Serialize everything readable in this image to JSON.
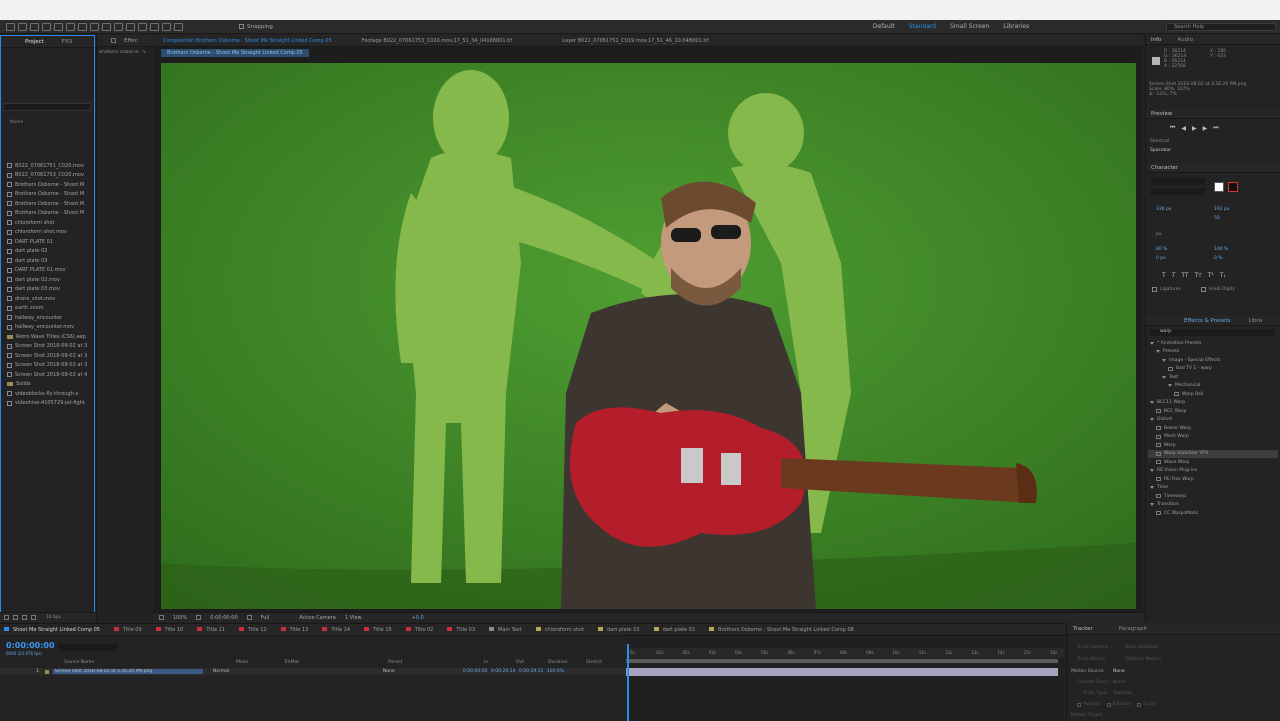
{
  "toolbar": {
    "snapping_label": "Snapping",
    "workspaces": [
      "Default",
      "Standard",
      "Small Screen",
      "Libraries"
    ],
    "active_workspace": "Standard",
    "search_placeholder": "Search Help"
  },
  "project_panel": {
    "tabs": [
      "Project",
      "FX3"
    ],
    "column_name": "Name",
    "items": [
      {
        "label": "B022_07061751_C020.mov",
        "kind": "file"
      },
      {
        "label": "B022_07061753_C020.mov",
        "kind": "file"
      },
      {
        "label": "Brothers Osborne - Shoot M",
        "kind": "comp"
      },
      {
        "label": "Brothers Osborne - Shoot M",
        "kind": "comp"
      },
      {
        "label": "Brothers Osborne - Shoot M",
        "kind": "comp"
      },
      {
        "label": "Brothers Osborne - Shoot M",
        "kind": "comp"
      },
      {
        "label": "chloroform shot",
        "kind": "comp"
      },
      {
        "label": "chloroform shot.mov",
        "kind": "file"
      },
      {
        "label": "DART PLATE 01",
        "kind": "comp"
      },
      {
        "label": "dart plate 02",
        "kind": "comp"
      },
      {
        "label": "dart plate 03",
        "kind": "comp"
      },
      {
        "label": "DART PLATE 01.mov",
        "kind": "file"
      },
      {
        "label": "dart plate 02.mov",
        "kind": "file"
      },
      {
        "label": "dart plate 03.mov",
        "kind": "file"
      },
      {
        "label": "drone_shot.mov",
        "kind": "file"
      },
      {
        "label": "earth zoom",
        "kind": "comp"
      },
      {
        "label": "hallway_encounter",
        "kind": "comp"
      },
      {
        "label": "hallway_encounter.mov",
        "kind": "file"
      },
      {
        "label": "Retro Wave Titles (CS6).aep",
        "kind": "folder"
      },
      {
        "label": "Screen Shot 2018-08-02 at 3",
        "kind": "file"
      },
      {
        "label": "Screen Shot 2018-08-02 at 3",
        "kind": "file"
      },
      {
        "label": "Screen Shot 2018-08-02 at 3",
        "kind": "file"
      },
      {
        "label": "Screen Shot 2018-08-02 at 4",
        "kind": "file"
      },
      {
        "label": "Solids",
        "kind": "folder"
      },
      {
        "label": "videoblocks-fly-through-s",
        "kind": "file"
      },
      {
        "label": "videohive-4105729-jet-fight",
        "kind": "file"
      }
    ],
    "footer_depth": "16 bpc"
  },
  "effect_panel": {
    "tab_label": "Effec",
    "subtitle": "Brothers Osborne - S"
  },
  "comp_panel": {
    "tabs": [
      {
        "label": "Composition Brothers Osborne - Shoot Me Straight Linked Comp 05",
        "active": true
      },
      {
        "label": "Footage B022_07061753_C020.mov.17_51_34_04168001.tif",
        "active": false
      },
      {
        "label": "Layer B022_07061751_C019.mov.17_51_46_10.04B001.tif",
        "active": false
      }
    ],
    "breadcrumb": "Brothers Osborne - Shoot Me Straight Linked Comp 05",
    "footer": {
      "zoom": "100%",
      "timecode": "0:00:00:00",
      "resolution": "Full",
      "camera": "Active Camera",
      "views": "1 View",
      "exposure": "+0.0"
    }
  },
  "info_panel": {
    "tabs": [
      "Info",
      "Audio"
    ],
    "rgb": [
      "R : 36214",
      "G : 36214",
      "B : 36214",
      "A : 32768"
    ],
    "xy": [
      "X : 185",
      "Y : 433"
    ],
    "file_line": "Screen Shot 2018-08-02 at 3.56.20 PM.png",
    "scale_line": "Scale: 80%, 107%",
    "offset_line": "Δ: -12%,-7%"
  },
  "preview_panel": {
    "title": "Preview",
    "shortcut_label": "Shortcut",
    "shortcut_value": "Spacebar"
  },
  "character_panel": {
    "title": "Character",
    "font_size": "336 px",
    "leading": "192 px",
    "tracking": "50",
    "unit": "px",
    "v_scale": "80 %",
    "h_scale": "100 %",
    "baseline": "0 px",
    "tsume": "0 %",
    "ligatures_label": "Ligatures",
    "hindi_label": "Hindi Digits"
  },
  "effects_presets": {
    "tabs": [
      "Effects & Presets",
      "Libra"
    ],
    "search_value": "warp",
    "items": [
      {
        "label": "* Animation Presets",
        "level": 0,
        "type": "group"
      },
      {
        "label": "Presets",
        "level": 1,
        "type": "group"
      },
      {
        "label": "Image - Special Effects",
        "level": 2,
        "type": "group"
      },
      {
        "label": "Bad TV 1 - warp",
        "level": 3,
        "type": "item"
      },
      {
        "label": "Text",
        "level": 2,
        "type": "group"
      },
      {
        "label": "Mechanical",
        "level": 3,
        "type": "group"
      },
      {
        "label": "Warp Roll",
        "level": 4,
        "type": "item"
      },
      {
        "label": "BCC11 Warp",
        "level": 0,
        "type": "group"
      },
      {
        "label": "BCC Warp",
        "level": 1,
        "type": "item"
      },
      {
        "label": "Distort",
        "level": 0,
        "type": "group"
      },
      {
        "label": "Bezier Warp",
        "level": 1,
        "type": "item"
      },
      {
        "label": "Mesh Warp",
        "level": 1,
        "type": "item"
      },
      {
        "label": "Warp",
        "level": 1,
        "type": "item"
      },
      {
        "label": "Warp Stabilizer VFX",
        "level": 1,
        "type": "item",
        "selected": true
      },
      {
        "label": "Wave Warp",
        "level": 1,
        "type": "item"
      },
      {
        "label": "RE:Vision Plug-ins",
        "level": 0,
        "type": "group"
      },
      {
        "label": "RE:Flex Warp",
        "level": 1,
        "type": "item"
      },
      {
        "label": "Time",
        "level": 0,
        "type": "group"
      },
      {
        "label": "Timewarp",
        "level": 1,
        "type": "item"
      },
      {
        "label": "Transition",
        "level": 0,
        "type": "group"
      },
      {
        "label": "CC WarpoMatic",
        "level": 1,
        "type": "item"
      }
    ]
  },
  "timeline": {
    "tabs": [
      {
        "label": "Shoot Me Straight Linked Comp 05",
        "color": "#2d8ceb",
        "active": true
      },
      {
        "label": "Title 09",
        "color": "#c8303a"
      },
      {
        "label": "Title 10",
        "color": "#c8303a"
      },
      {
        "label": "Title 11",
        "color": "#c8303a"
      },
      {
        "label": "Title 12",
        "color": "#c8303a"
      },
      {
        "label": "Title 13",
        "color": "#c8303a"
      },
      {
        "label": "Title 14",
        "color": "#c8303a"
      },
      {
        "label": "Title 15",
        "color": "#c8303a"
      },
      {
        "label": "Title 02",
        "color": "#c8303a"
      },
      {
        "label": "Title 03",
        "color": "#c8303a"
      },
      {
        "label": "Main Text",
        "color": "#8c8c8c"
      },
      {
        "label": "chloroform shot",
        "color": "#b7a65c"
      },
      {
        "label": "dart plate 03",
        "color": "#b7a65c"
      },
      {
        "label": "dart plate 02",
        "color": "#b7a65c"
      },
      {
        "label": "Brothers Osborne - Shoot Me Straight Linked Comp 08",
        "color": "#b7a65c"
      }
    ],
    "timecode": "0:00:00:00",
    "fps": "0000 (23.976 fps)",
    "columns": [
      "Source Name",
      "Mode",
      "TrkMat",
      "Parent",
      "In",
      "Out",
      "Duration",
      "Stretch"
    ],
    "layer": {
      "number": "1",
      "name": "Screen Shot 2018-08-02 at 3.56.20 PM.png",
      "mode": "Normal",
      "parent": "None",
      "in": "0:00:00:00",
      "out": "0:00:29:14",
      "duration": "0:00:29:15",
      "stretch": "100.0%"
    },
    "ruler_ticks": [
      "0s",
      "01s",
      "02s",
      "03s",
      "04s",
      "05s",
      "06s",
      "07s",
      "08s",
      "09s",
      "10s",
      "11s",
      "12s",
      "13s",
      "14s",
      "15s",
      "16s"
    ]
  },
  "tracker": {
    "tabs": [
      "Tracker",
      "Paragraph"
    ],
    "buttons": [
      "Track Camera",
      "Warp Stabilizer",
      "Track Motion",
      "Stabilize Motion"
    ],
    "motion_source_label": "Motion Source:",
    "motion_source_value": "None",
    "current_track_label": "Current Track:",
    "current_track_value": "None",
    "track_type_label": "Track Type:",
    "track_type_value": "Stabilize",
    "checks": [
      "Position",
      "Rotation",
      "Scale"
    ],
    "motion_target_label": "Motion Target:"
  },
  "colors": {
    "accent": "#2d8ceb",
    "green_screen": "#3f8a26",
    "panel": "#232323"
  }
}
